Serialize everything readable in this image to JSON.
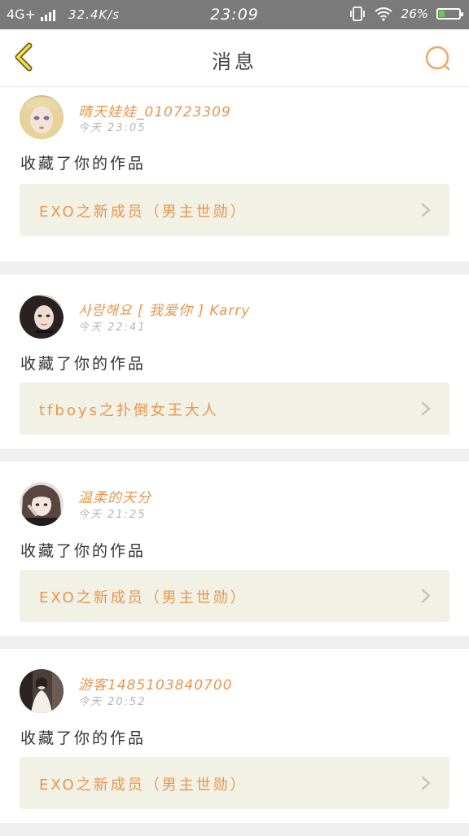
{
  "status_bar": {
    "network": "4G+",
    "speed": "32.4K/s",
    "time": "23:09",
    "battery": "26%",
    "battery_level": 0.26,
    "battery_color": "#5ad14a"
  },
  "header": {
    "title": "消息",
    "back_icon": "chevron-left-icon",
    "search_icon": "search-icon",
    "accent": "#e8964e"
  },
  "messages": [
    {
      "username": "晴天娃娃_010723309",
      "time": "今天 23:05",
      "action": "收藏了你的作品",
      "work_title": "EXO之新成员（男主世勋）"
    },
    {
      "username": "사랑해요 [ 我爱你 ] Karry",
      "time": "今天 22:41",
      "action": "收藏了你的作品",
      "work_title": "tfboys之扑倒女王大人"
    },
    {
      "username": "温柔的天分",
      "time": "今天 21:25",
      "action": "收藏了你的作品",
      "work_title": "EXO之新成员（男主世勋）"
    },
    {
      "username": "游客1485103840700",
      "time": "今天 20:52",
      "action": "收藏了你的作品",
      "work_title": "EXO之新成员（男主世勋）"
    }
  ]
}
